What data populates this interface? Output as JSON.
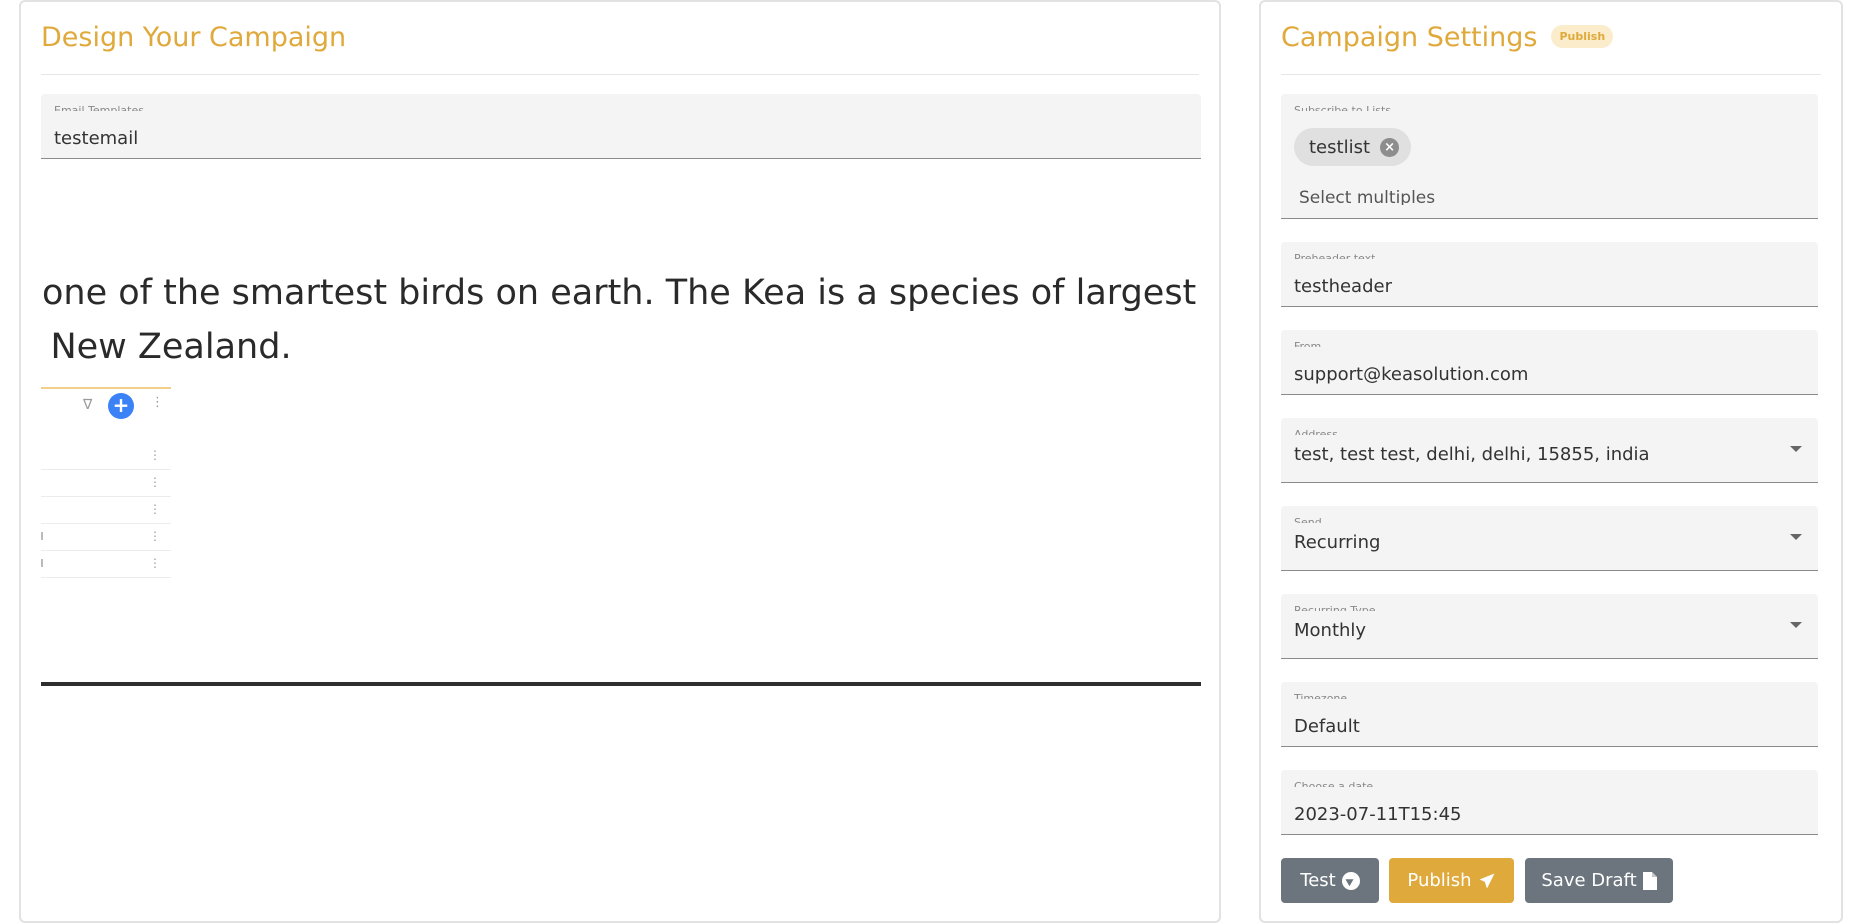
{
  "design": {
    "title": "Design Your Campaign",
    "template_field": {
      "label": "Email Templates",
      "value": "testemail"
    },
    "preview": {
      "line1": "one of the smartest birds on earth. The Kea is a species of largest",
      "line2": "f New Zealand."
    }
  },
  "settings": {
    "title": "Campaign Settings",
    "status_badge": "Publish",
    "lists_field": {
      "label": "Subscribe to Lists",
      "chips": [
        "testlist"
      ],
      "placeholder": "Select multiples"
    },
    "preheader_field": {
      "label": "Preheader text",
      "value": "testheader"
    },
    "from_field": {
      "label": "From",
      "value": "support@keasolution.com"
    },
    "address_field": {
      "label": "Address",
      "value": "test, test test, delhi, delhi, 15855, india"
    },
    "send_field": {
      "label": "Send",
      "value": "Recurring"
    },
    "recurring_type_field": {
      "label": "Recurring Type",
      "value": "Monthly"
    },
    "timezone_field": {
      "label": "Timezone",
      "value": "Default"
    },
    "date_field": {
      "label": "Choose a date",
      "value": "2023-07-11T15:45"
    },
    "buttons": {
      "test": "Test",
      "publish": "Publish",
      "save_draft": "Save Draft"
    }
  },
  "icons": {
    "chip_remove": "close-circle-icon",
    "test": "telegram-icon",
    "publish": "paper-plane-icon",
    "save_draft": "file-icon",
    "dropdown": "caret-down-icon"
  },
  "colors": {
    "accent": "#e0a93b",
    "secondary_button": "#6c757d",
    "plus_button": "#3b82f6"
  }
}
